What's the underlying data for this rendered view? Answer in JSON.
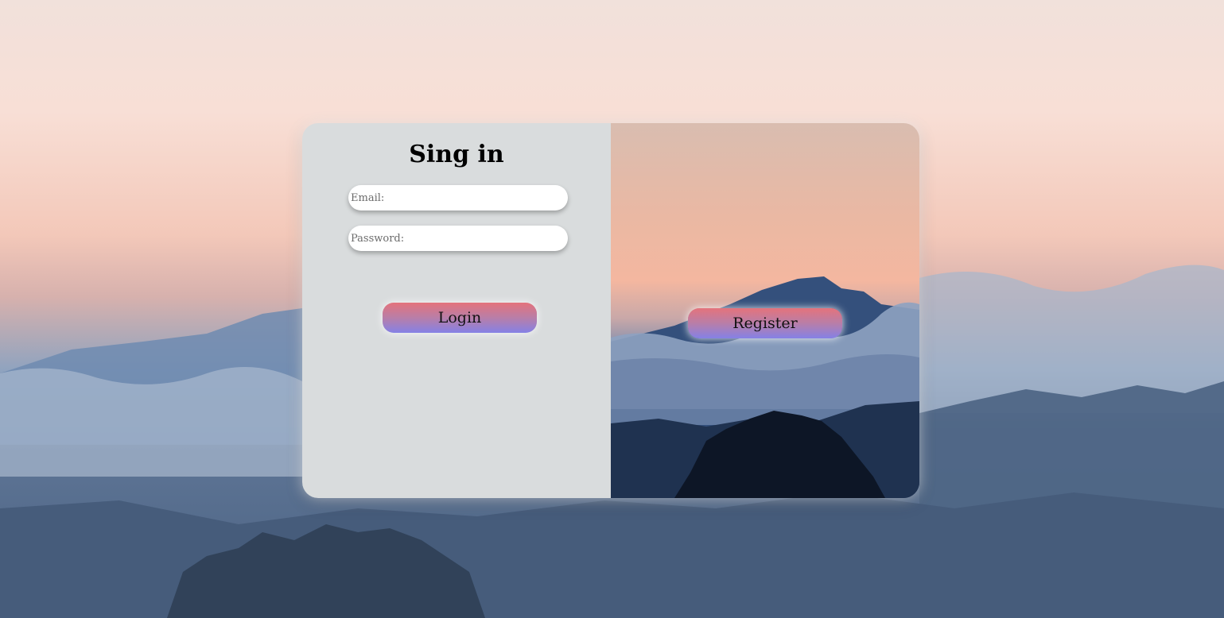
{
  "signin": {
    "title": "Sing in",
    "email_placeholder": "Email:",
    "password_placeholder": "Password:",
    "login_label": "Login"
  },
  "register": {
    "register_label": "Register"
  },
  "colors": {
    "button_gradient_top": "#e4737c",
    "button_gradient_bottom": "#8581e6",
    "panel_background": "#d9dcdd"
  }
}
